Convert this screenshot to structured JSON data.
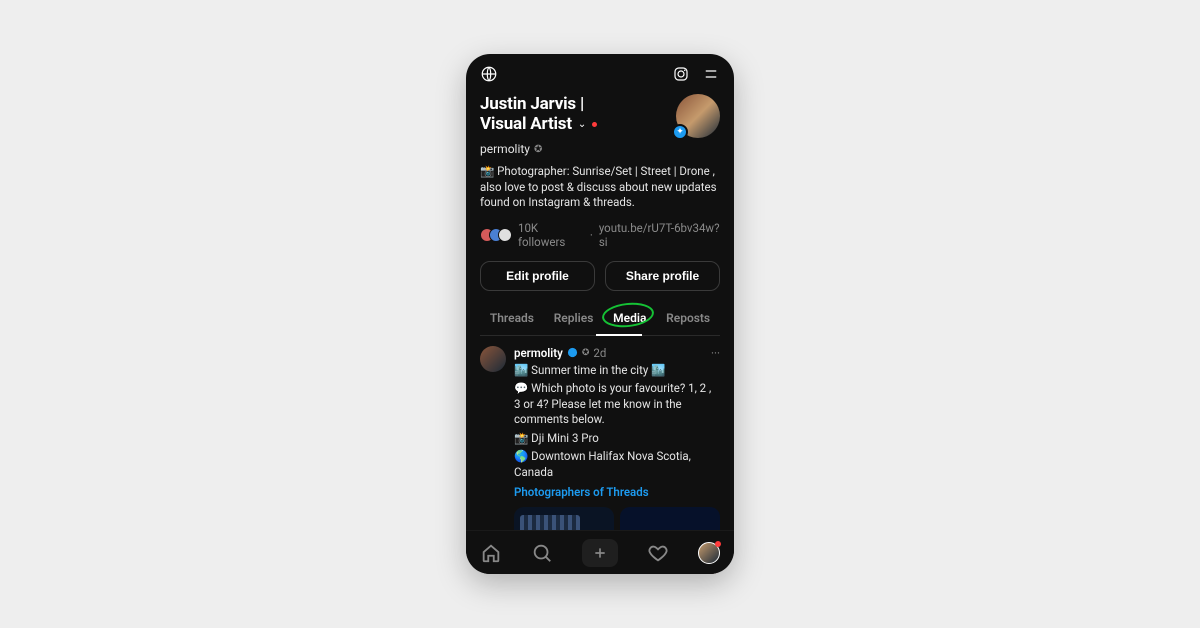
{
  "header": {
    "language_icon": "globe",
    "instagram_icon": "instagram",
    "menu_icon": "menu"
  },
  "profile": {
    "name_l1": "Justin Jarvis |",
    "name_l2": "Visual Artist",
    "handle": "permolity",
    "handle_badge": "✪",
    "bio": "📸 Photographer: Sunrise/Set | Street | Drone , also love to post & discuss about new updates found on Instagram & threads.",
    "followers": "10K followers",
    "link": "youtu.be/rU7T-6bv34w?si",
    "separator": " · ",
    "edit_label": "Edit profile",
    "share_label": "Share profile"
  },
  "tabs": {
    "threads": "Threads",
    "replies": "Replies",
    "media": "Media",
    "reposts": "Reposts",
    "active": "media"
  },
  "post": {
    "username": "permolity",
    "time_badge": "✪",
    "time": "2d",
    "ellipsis": "···",
    "line1_a": "🏙️ Sunmer time in the city 🏙️",
    "line2": "💬 Which photo is your favourite? 1, 2 , 3 or 4? Please let me know in the comments below.",
    "line3": "📸 Dji Mini 3 Pro",
    "line4": "🌎 Downtown Halifax Nova Scotia, Canada",
    "link": "Photographers of Threads"
  },
  "nav": {
    "home": "home",
    "search": "search",
    "compose": "plus",
    "activity": "heart",
    "profile": "avatar"
  }
}
